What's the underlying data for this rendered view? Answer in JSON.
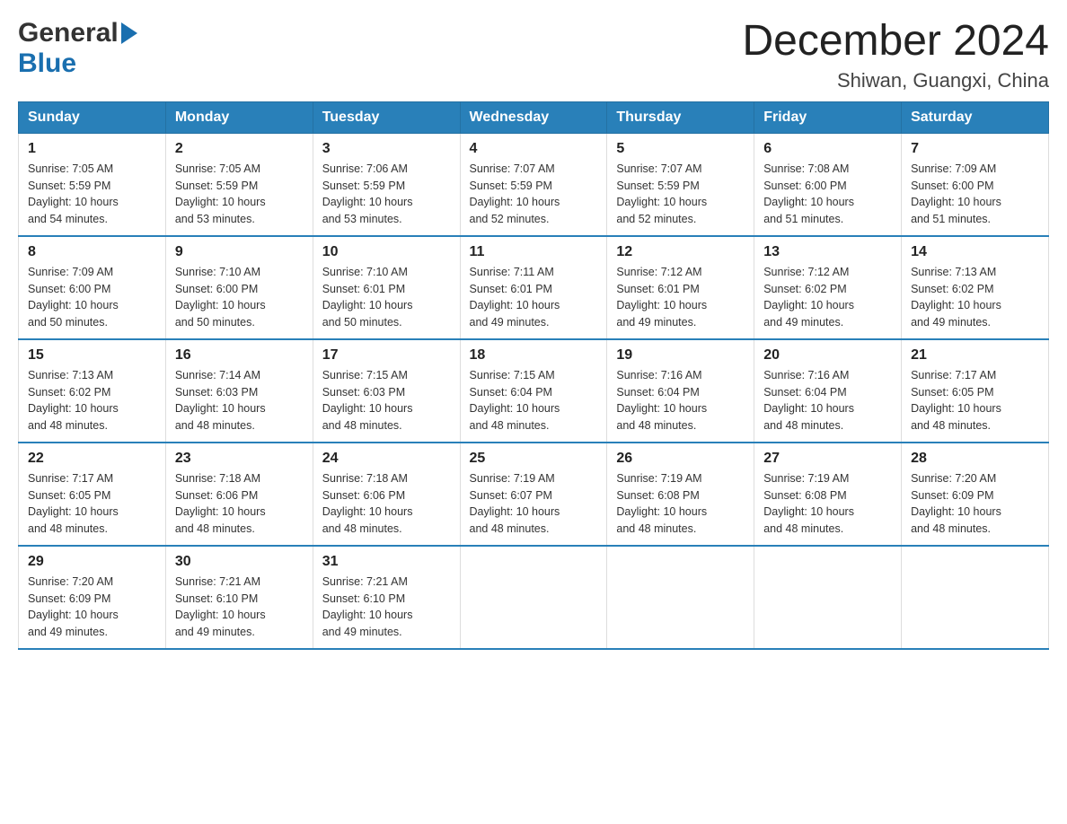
{
  "header": {
    "logo_general": "General",
    "logo_blue": "Blue",
    "title": "December 2024",
    "subtitle": "Shiwan, Guangxi, China"
  },
  "days_of_week": [
    "Sunday",
    "Monday",
    "Tuesday",
    "Wednesday",
    "Thursday",
    "Friday",
    "Saturday"
  ],
  "weeks": [
    [
      {
        "day": "1",
        "sunrise": "7:05 AM",
        "sunset": "5:59 PM",
        "daylight": "10 hours and 54 minutes."
      },
      {
        "day": "2",
        "sunrise": "7:05 AM",
        "sunset": "5:59 PM",
        "daylight": "10 hours and 53 minutes."
      },
      {
        "day": "3",
        "sunrise": "7:06 AM",
        "sunset": "5:59 PM",
        "daylight": "10 hours and 53 minutes."
      },
      {
        "day": "4",
        "sunrise": "7:07 AM",
        "sunset": "5:59 PM",
        "daylight": "10 hours and 52 minutes."
      },
      {
        "day": "5",
        "sunrise": "7:07 AM",
        "sunset": "5:59 PM",
        "daylight": "10 hours and 52 minutes."
      },
      {
        "day": "6",
        "sunrise": "7:08 AM",
        "sunset": "6:00 PM",
        "daylight": "10 hours and 51 minutes."
      },
      {
        "day": "7",
        "sunrise": "7:09 AM",
        "sunset": "6:00 PM",
        "daylight": "10 hours and 51 minutes."
      }
    ],
    [
      {
        "day": "8",
        "sunrise": "7:09 AM",
        "sunset": "6:00 PM",
        "daylight": "10 hours and 50 minutes."
      },
      {
        "day": "9",
        "sunrise": "7:10 AM",
        "sunset": "6:00 PM",
        "daylight": "10 hours and 50 minutes."
      },
      {
        "day": "10",
        "sunrise": "7:10 AM",
        "sunset": "6:01 PM",
        "daylight": "10 hours and 50 minutes."
      },
      {
        "day": "11",
        "sunrise": "7:11 AM",
        "sunset": "6:01 PM",
        "daylight": "10 hours and 49 minutes."
      },
      {
        "day": "12",
        "sunrise": "7:12 AM",
        "sunset": "6:01 PM",
        "daylight": "10 hours and 49 minutes."
      },
      {
        "day": "13",
        "sunrise": "7:12 AM",
        "sunset": "6:02 PM",
        "daylight": "10 hours and 49 minutes."
      },
      {
        "day": "14",
        "sunrise": "7:13 AM",
        "sunset": "6:02 PM",
        "daylight": "10 hours and 49 minutes."
      }
    ],
    [
      {
        "day": "15",
        "sunrise": "7:13 AM",
        "sunset": "6:02 PM",
        "daylight": "10 hours and 48 minutes."
      },
      {
        "day": "16",
        "sunrise": "7:14 AM",
        "sunset": "6:03 PM",
        "daylight": "10 hours and 48 minutes."
      },
      {
        "day": "17",
        "sunrise": "7:15 AM",
        "sunset": "6:03 PM",
        "daylight": "10 hours and 48 minutes."
      },
      {
        "day": "18",
        "sunrise": "7:15 AM",
        "sunset": "6:04 PM",
        "daylight": "10 hours and 48 minutes."
      },
      {
        "day": "19",
        "sunrise": "7:16 AM",
        "sunset": "6:04 PM",
        "daylight": "10 hours and 48 minutes."
      },
      {
        "day": "20",
        "sunrise": "7:16 AM",
        "sunset": "6:04 PM",
        "daylight": "10 hours and 48 minutes."
      },
      {
        "day": "21",
        "sunrise": "7:17 AM",
        "sunset": "6:05 PM",
        "daylight": "10 hours and 48 minutes."
      }
    ],
    [
      {
        "day": "22",
        "sunrise": "7:17 AM",
        "sunset": "6:05 PM",
        "daylight": "10 hours and 48 minutes."
      },
      {
        "day": "23",
        "sunrise": "7:18 AM",
        "sunset": "6:06 PM",
        "daylight": "10 hours and 48 minutes."
      },
      {
        "day": "24",
        "sunrise": "7:18 AM",
        "sunset": "6:06 PM",
        "daylight": "10 hours and 48 minutes."
      },
      {
        "day": "25",
        "sunrise": "7:19 AM",
        "sunset": "6:07 PM",
        "daylight": "10 hours and 48 minutes."
      },
      {
        "day": "26",
        "sunrise": "7:19 AM",
        "sunset": "6:08 PM",
        "daylight": "10 hours and 48 minutes."
      },
      {
        "day": "27",
        "sunrise": "7:19 AM",
        "sunset": "6:08 PM",
        "daylight": "10 hours and 48 minutes."
      },
      {
        "day": "28",
        "sunrise": "7:20 AM",
        "sunset": "6:09 PM",
        "daylight": "10 hours and 48 minutes."
      }
    ],
    [
      {
        "day": "29",
        "sunrise": "7:20 AM",
        "sunset": "6:09 PM",
        "daylight": "10 hours and 49 minutes."
      },
      {
        "day": "30",
        "sunrise": "7:21 AM",
        "sunset": "6:10 PM",
        "daylight": "10 hours and 49 minutes."
      },
      {
        "day": "31",
        "sunrise": "7:21 AM",
        "sunset": "6:10 PM",
        "daylight": "10 hours and 49 minutes."
      },
      null,
      null,
      null,
      null
    ]
  ],
  "labels": {
    "sunrise": "Sunrise:",
    "sunset": "Sunset:",
    "daylight": "Daylight:"
  }
}
